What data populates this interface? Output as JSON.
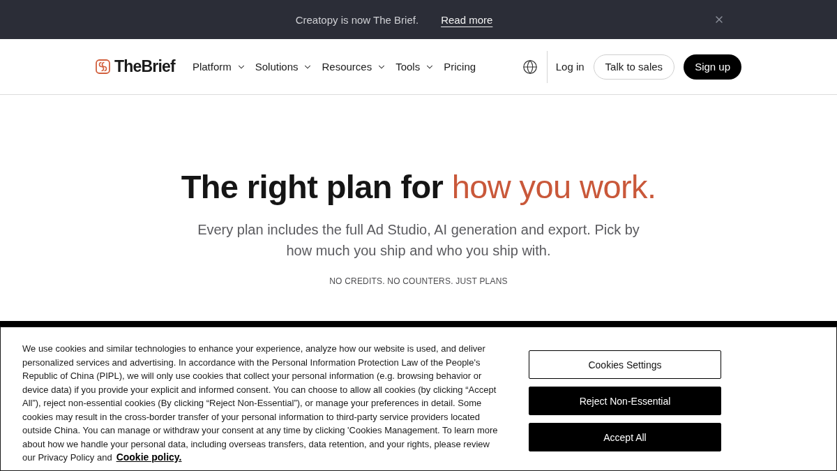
{
  "announcement": {
    "text": "Creatopy is now The Brief.",
    "link": "Read more",
    "dismissible": true
  },
  "header": {
    "logo": "TheBrief",
    "nav": [
      {
        "label": "Platform",
        "dropdown": true
      },
      {
        "label": "Solutions",
        "dropdown": true
      },
      {
        "label": "Resources",
        "dropdown": true
      },
      {
        "label": "Tools",
        "dropdown": true
      },
      {
        "label": "Pricing",
        "dropdown": false
      }
    ],
    "actions": [
      {
        "label": "Log in",
        "kind": "text"
      },
      {
        "label": "Talk to sales",
        "kind": "outline"
      },
      {
        "label": "Sign up",
        "kind": "filled"
      }
    ]
  },
  "hero": {
    "title": [
      {
        "text": "The right plan for",
        "accent": false
      },
      {
        "text": "how you work.",
        "accent": true
      }
    ],
    "subtitle": "Every plan includes the full Ad Studio, AI generation and export. Pick by how much you ship and who you ship with.",
    "tagline": "NO CREDITS. NO COUNTERS. JUST PLANS"
  },
  "cookie_banner": {
    "text": "We use cookies and similar technologies to enhance your experience, analyze how our website is used, and deliver personalized services and advertising. In accordance with the Personal Information Protection Law of the People's Republic of China (PIPL), we will only use cookies that collect your personal information (e.g. browsing behavior or device data) if you provide your explicit and informed consent. You can choose to allow all cookies (by clicking “Accept All”), reject non-essential cookies (By clicking “Reject Non-Essential”), or manage your preferences in detail. Some cookies may result in the cross-border transfer of your personal information to third-party service providers located outside China. You can manage or withdraw your consent at any time by clicking 'Cookies Management. To learn more about how we handle your personal data, including overseas transfers, data retention, and your rights, please review our Privacy Policy and",
    "link": "Cookie policy.",
    "buttons": [
      {
        "label": "Cookies Settings",
        "kind": "outline"
      },
      {
        "label": "Reject Non-Essential",
        "kind": "filled"
      },
      {
        "label": "Accept All",
        "kind": "filled"
      }
    ]
  }
}
